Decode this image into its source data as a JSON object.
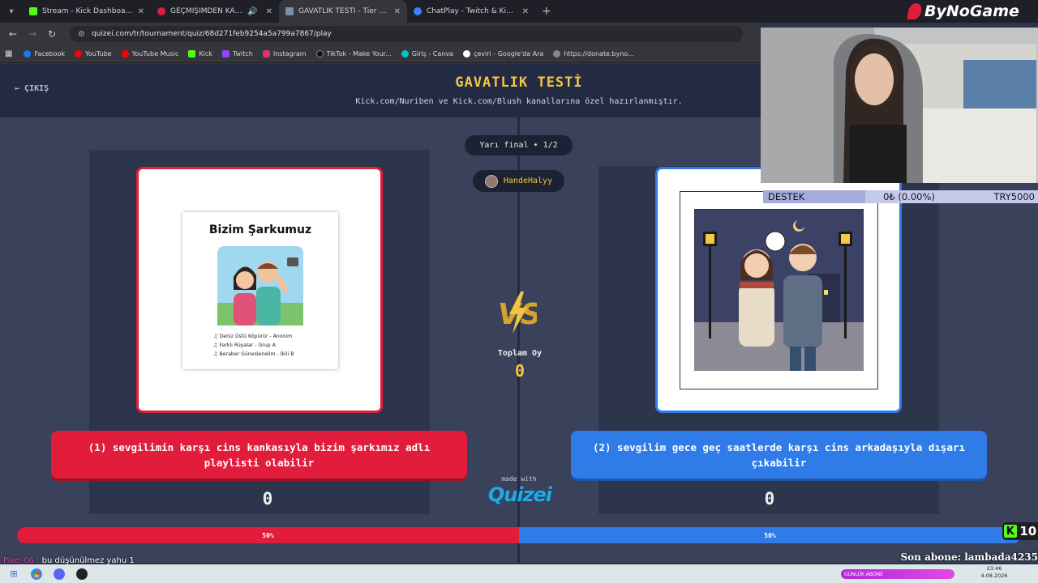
{
  "browser": {
    "tabs": [
      {
        "title": "Stream - Kick Dashboard",
        "color": "#53fc18"
      },
      {
        "title": "GEÇMİŞİMDEN KAÇTIM | Yo",
        "color": "#e21c3b"
      },
      {
        "title": "GAVATLIK TESTİ - Tier List, Kör",
        "color": "#7a8fb0",
        "active": true
      },
      {
        "title": "ChatPlay - Twitch & Kick İzleyic",
        "color": "#3b82f6"
      }
    ],
    "url": "quizei.com/tr/tournament/quiz/68d271feb9254a5a799a7867/play",
    "bookmarks": [
      {
        "label": "Facebook",
        "color": "#1877f2"
      },
      {
        "label": "YouTube",
        "color": "#ff0000"
      },
      {
        "label": "YouTube Music",
        "color": "#ff0000"
      },
      {
        "label": "Kick",
        "color": "#53fc18"
      },
      {
        "label": "Twitch",
        "color": "#9146ff"
      },
      {
        "label": "Instagram",
        "color": "#e1306c"
      },
      {
        "label": "TikTok - Make Your...",
        "color": "#111111"
      },
      {
        "label": "Giriş - Canva",
        "color": "#00c4cc"
      },
      {
        "label": "çeviri - Google'da Ara",
        "color": "#ffffff"
      },
      {
        "label": "https://donate.byno...",
        "color": "#888888"
      }
    ]
  },
  "page": {
    "exit_label": "ÇIKIŞ",
    "title": "GAVATLIK TESTİ",
    "subtitle": "Kick.com/Nuriben ve Kick.com/Blush kanallarına özel hazırlanmıştır.",
    "round": "Yarı final • 1/2",
    "user": "HandeHalyy",
    "vs": "VS",
    "total_label": "Toplam Oy",
    "total_value": "0",
    "made_with": "made with",
    "brand": "Quizei"
  },
  "option1": {
    "text": "(1) sevgilimin karşı cins kankasıyla bizim şarkımız adlı playlisti olabilir",
    "votes": "0",
    "percent_label": "50%",
    "share": 0.5,
    "card_title": "Bizim Şarkumuz",
    "songs": [
      "Deniz Üstü Köpürür - Anonim",
      "Farklı Rüyalar - Grup A",
      "Beraber Güneslenelim - İkili B"
    ]
  },
  "option2": {
    "text": "(2) sevgilim gece geç saatlerde karşı cins arkadaşıyla dışarı çıkabilir",
    "votes": "0",
    "percent_label": "50%",
    "share": 0.5
  },
  "overlay": {
    "logo": "ByNoGame",
    "donate_label": "DESTEK",
    "donate_amount": "0₺ (0.00%)",
    "donate_goal": "TRY5000",
    "kick_count": "10",
    "chat_nick": "Pike_06 :",
    "chat_msg": "bu düşünülmez yahu 1",
    "last_sub": "Son abone: lambada4235"
  },
  "taskbar": {
    "progress_label": "GÜNLÜK ABONE",
    "time": "23:46",
    "date": "4.08.2026"
  },
  "colors": {
    "red": "#e21c3b",
    "blue": "#2f7be8",
    "gold": "#f4c540",
    "kick": "#53fc18"
  }
}
